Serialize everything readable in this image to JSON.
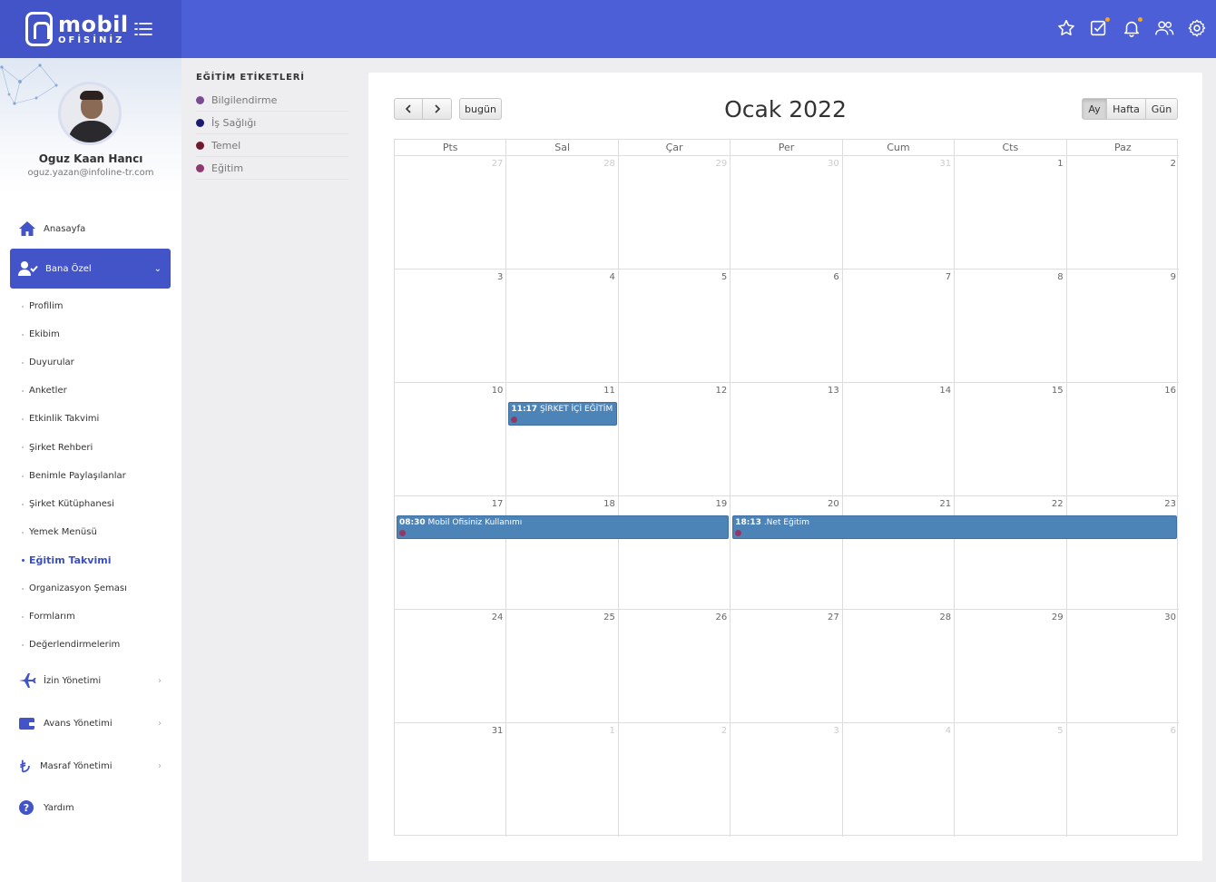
{
  "brand": {
    "line1": "mobil",
    "line2": "OFİSİNİZ"
  },
  "header": {
    "icons": [
      "star-icon",
      "task-check-icon",
      "bell-icon",
      "users-icon",
      "gear-icon"
    ]
  },
  "profile": {
    "name": "Oguz Kaan Hancı",
    "email": "oguz.yazan@infoline-tr.com"
  },
  "nav": {
    "home": "Anasayfa",
    "bana_ozel": "Bana Özel",
    "sub": [
      "Profilim",
      "Ekibim",
      "Duyurular",
      "Anketler",
      "Etkinlik Takvimi",
      "Şirket Rehberi",
      "Benimle Paylaşılanlar",
      "Şirket Kütüphanesi",
      "Yemek Menüsü",
      "Eğitim Takvimi",
      "Organizasyon Şeması",
      "Formlarım",
      "Değerlendirmelerim"
    ],
    "izin": "İzin Yönetimi",
    "avans": "Avans Yönetimi",
    "masraf": "Masraf Yönetimi",
    "yardim": "Yardım"
  },
  "tags": {
    "title": "EĞİTİM ETİKETLERİ",
    "items": [
      {
        "label": "Bilgilendirme",
        "color": "#7b4a92"
      },
      {
        "label": "İş Sağlığı",
        "color": "#1a1a6e"
      },
      {
        "label": "Temel",
        "color": "#6e1a2e"
      },
      {
        "label": "Eğitim",
        "color": "#8e3a70"
      }
    ]
  },
  "calendar": {
    "title": "Ocak 2022",
    "today_label": "bugün",
    "views": [
      "Ay",
      "Hafta",
      "Gün"
    ],
    "days": [
      "Pts",
      "Sal",
      "Çar",
      "Per",
      "Cum",
      "Cts",
      "Paz"
    ],
    "weeks": [
      [
        "27",
        "28",
        "29",
        "30",
        "31",
        "1",
        "2"
      ],
      [
        "3",
        "4",
        "5",
        "6",
        "7",
        "8",
        "9"
      ],
      [
        "10",
        "11",
        "12",
        "13",
        "14",
        "15",
        "16"
      ],
      [
        "17",
        "18",
        "19",
        "20",
        "21",
        "22",
        "23"
      ],
      [
        "24",
        "25",
        "26",
        "27",
        "28",
        "29",
        "30"
      ],
      [
        "31",
        "1",
        "2",
        "3",
        "4",
        "5",
        "6"
      ]
    ],
    "events": [
      {
        "time": "11:17",
        "title": "ŞİRKET İÇİ EĞİTİM"
      },
      {
        "time": "08:30",
        "title": "Mobil Ofisiniz Kullanımı"
      },
      {
        "time": "18:13",
        "title": ".Net Eğitim"
      }
    ]
  }
}
